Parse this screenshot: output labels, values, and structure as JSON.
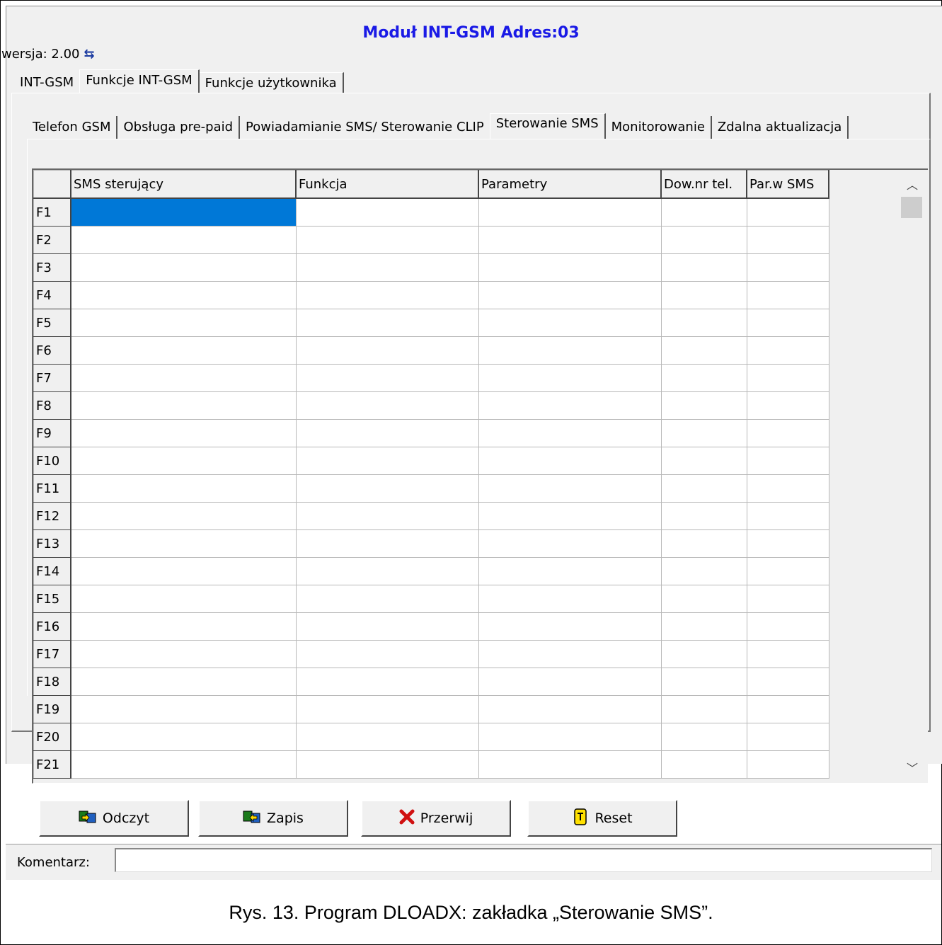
{
  "window": {
    "title": "Moduł INT-GSM Adres:03",
    "version_label": "wersja: 2.00"
  },
  "tabs_main": [
    {
      "label": "INT-GSM",
      "active": false
    },
    {
      "label": "Funkcje INT-GSM",
      "active": true
    },
    {
      "label": "Funkcje użytkownika",
      "active": false
    }
  ],
  "tabs_sub": [
    {
      "label": "Telefon GSM",
      "active": false
    },
    {
      "label": "Obsługa pre-paid",
      "active": false
    },
    {
      "label": "Powiadamianie SMS/ Sterowanie CLIP",
      "active": false
    },
    {
      "label": "Sterowanie SMS",
      "active": true
    },
    {
      "label": "Monitorowanie",
      "active": false
    },
    {
      "label": "Zdalna aktualizacja",
      "active": false
    }
  ],
  "grid": {
    "columns": [
      "SMS sterujący",
      "Funkcja",
      "Parametry",
      "Dow.nr tel.",
      "Par.w SMS"
    ],
    "rows": [
      "F1",
      "F2",
      "F3",
      "F4",
      "F5",
      "F6",
      "F7",
      "F8",
      "F9",
      "F10",
      "F11",
      "F12",
      "F13",
      "F14",
      "F15",
      "F16",
      "F17",
      "F18",
      "F19",
      "F20",
      "F21"
    ],
    "selected_cell": {
      "row": "F1",
      "column": "SMS sterujący"
    }
  },
  "buttons": {
    "read": "Odczyt",
    "write": "Zapis",
    "abort": "Przerwij",
    "reset": "Reset"
  },
  "comment": {
    "label": "Komentarz:",
    "value": ""
  },
  "caption": "Rys. 13. Program DLOADX: zakładka „Sterowanie SMS”.",
  "colors": {
    "title": "#1a1ae6",
    "selection": "#0078d7",
    "window_bg": "#f0f0f0"
  }
}
